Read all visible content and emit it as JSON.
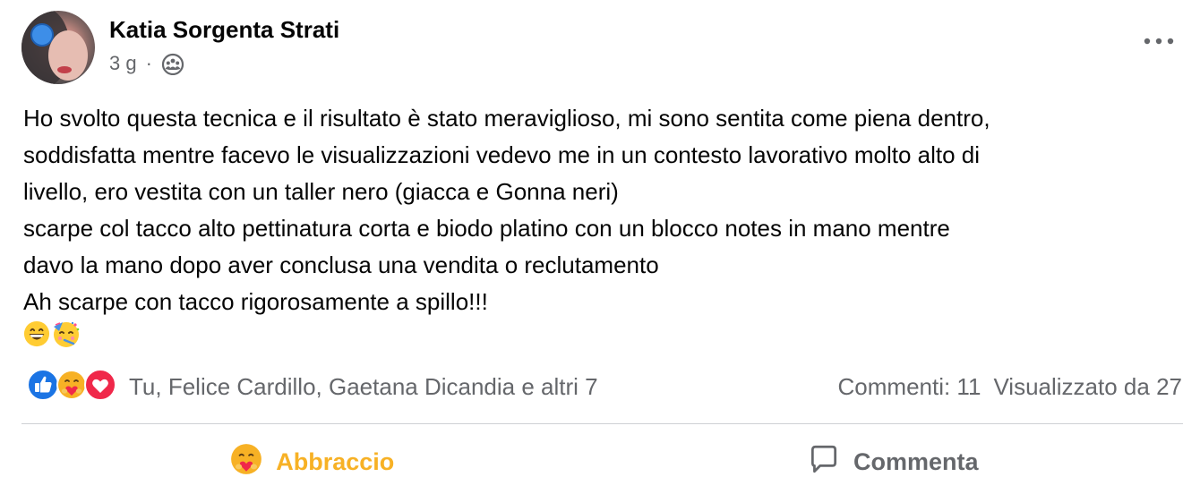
{
  "post": {
    "author": "Katia Sorgenta Strati",
    "time": "3 g",
    "separator": "·",
    "audience_icon": "group-icon",
    "more_icon": "more-horizontal-icon",
    "text_lines": [
      "Ho svolto questa tecnica e il risultato è stato meraviglioso, mi sono sentita come piena dentro,",
      "soddisfatta mentre facevo le visualizzazioni  vedevo me in un contesto lavorativo molto alto di",
      "livello, ero vestita con un taller nero (giacca e Gonna neri)",
      "scarpe col tacco alto pettinatura corta e biodo platino con un blocco notes in mano mentre",
      "davo la mano dopo aver conclusa una vendita o reclutamento",
      "Ah scarpe con tacco rigorosamente a spillo!!!"
    ],
    "emojis": [
      "grinning-face-icon",
      "partying-face-icon"
    ]
  },
  "reactions": {
    "icons": [
      "like-reaction-icon",
      "care-reaction-icon",
      "love-reaction-icon"
    ],
    "summary": "Tu, Felice Cardillo, Gaetana Dicandia e altri 7",
    "comments": "Commenti: 11",
    "views": "Visualizzato da 27"
  },
  "actions": {
    "hug_label": "Abbraccio",
    "comment_label": "Commenta"
  },
  "colors": {
    "text": "#050505",
    "secondary": "#65676b",
    "like_blue": "#1b74e4",
    "love_red": "#f0284a",
    "care_yellow": "#f7b125",
    "divider": "#ced0d4"
  }
}
